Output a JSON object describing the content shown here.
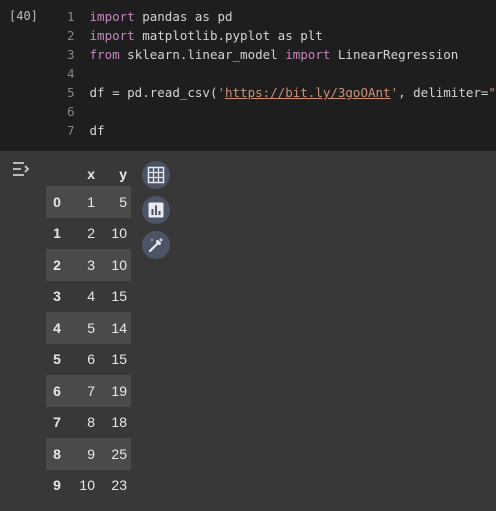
{
  "code_cell": {
    "execution_count": "[40]",
    "lines": [
      {
        "num": "1",
        "kw1": "import",
        "rest": " pandas as pd"
      },
      {
        "num": "2",
        "kw1": "import",
        "rest": " matplotlib.pyplot as plt"
      },
      {
        "num": "3",
        "kw1": "from",
        "mid": " sklearn.linear_model ",
        "kw2": "import",
        "rest": " LinearRegression"
      },
      {
        "num": "4"
      },
      {
        "num": "5",
        "pre": "df = pd.read_csv(",
        "q1": "'",
        "url": "https://bit.ly/3goOAnt",
        "q2": "'",
        "post1": ", delimiter=",
        "delim": "\",\"",
        "post2": ")"
      },
      {
        "num": "6"
      },
      {
        "num": "7",
        "text": "df"
      }
    ]
  },
  "output": {
    "columns": [
      "x",
      "y"
    ],
    "rows": [
      {
        "index": "0",
        "x": "1",
        "y": "5"
      },
      {
        "index": "1",
        "x": "2",
        "y": "10"
      },
      {
        "index": "2",
        "x": "3",
        "y": "10"
      },
      {
        "index": "3",
        "x": "4",
        "y": "15"
      },
      {
        "index": "4",
        "x": "5",
        "y": "14"
      },
      {
        "index": "5",
        "x": "6",
        "y": "15"
      },
      {
        "index": "6",
        "x": "7",
        "y": "19"
      },
      {
        "index": "7",
        "x": "8",
        "y": "18"
      },
      {
        "index": "8",
        "x": "9",
        "y": "25"
      },
      {
        "index": "9",
        "x": "10",
        "y": "23"
      }
    ],
    "action_icons": [
      "table-icon",
      "bar-chart-icon",
      "magic-wand-icon"
    ],
    "colors": {
      "button_bg": "#4b5565",
      "icon": "#e8eaed",
      "row_stripe": "#4a4a4a"
    }
  }
}
